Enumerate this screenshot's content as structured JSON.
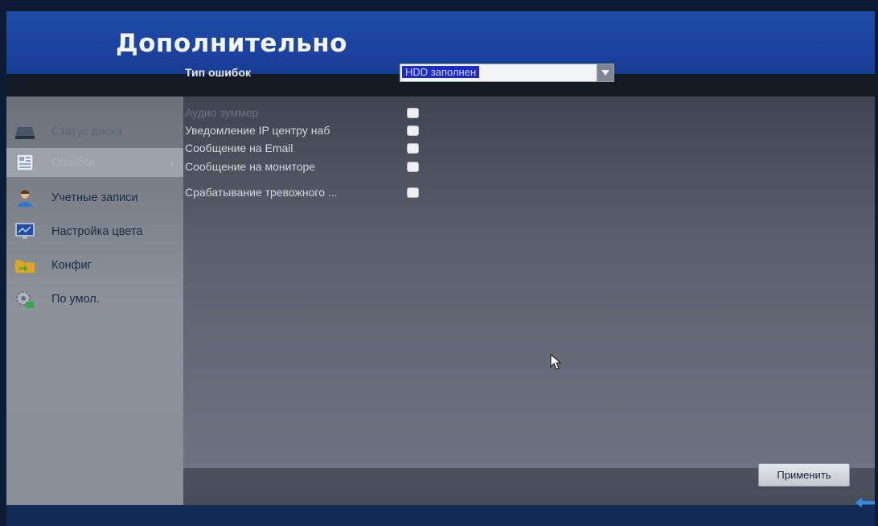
{
  "window": {
    "title": "Дополнительно"
  },
  "sidebar": {
    "items": [
      {
        "label": "Статус диска",
        "icon": "hdd-icon"
      },
      {
        "label": "Ошибки",
        "icon": "error-icon",
        "selected": true
      },
      {
        "label": "Учетные записи",
        "icon": "user-icon"
      },
      {
        "label": "Настройка цвета",
        "icon": "monitor-icon"
      },
      {
        "label": "Конфиг",
        "icon": "folder-icon"
      },
      {
        "label": "По умол.",
        "icon": "gear-icon"
      }
    ]
  },
  "main": {
    "error_type_label": "Тип ошибок",
    "error_type_value": "HDD заполнен",
    "options": [
      {
        "label": "Аудио зуммер",
        "checked": false
      },
      {
        "label": "Уведомление IP центру наб",
        "checked": false
      },
      {
        "label": "Сообщение на Email",
        "checked": false
      },
      {
        "label": "Сообщение на мониторе",
        "checked": false
      },
      {
        "label": "Срабатывание тревожного ...",
        "checked": false
      }
    ]
  },
  "footer": {
    "apply_label": "Применить"
  },
  "colors": {
    "title_bar": "#1e4ba6",
    "selection": "#1e2cc4",
    "sidebar": "#8d9199",
    "content": "#5a606c"
  }
}
